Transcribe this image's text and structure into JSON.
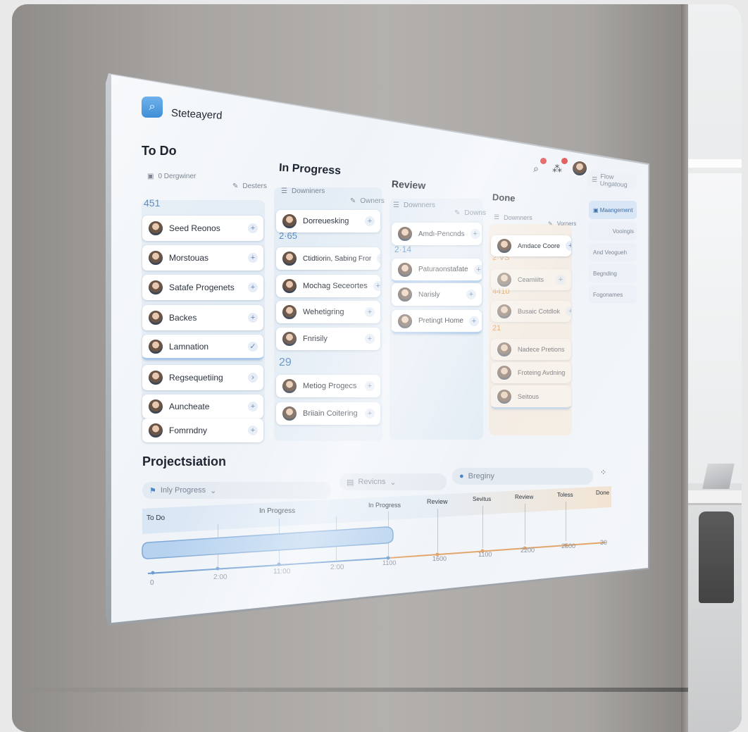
{
  "app": {
    "logo_icon": "search-icon",
    "name": "Steteayerd"
  },
  "topbar": {
    "icons": [
      "search-icon",
      "people-icon"
    ],
    "menu_pill": "Flow Ungatoug"
  },
  "columns": {
    "todo": {
      "title": "To Do",
      "filter_left": "0 Dergwiner",
      "filter_right": "Desters",
      "count": "451",
      "cards": [
        "Seed Reonos",
        "Morstouas",
        "Satafe Progenets",
        "Backes",
        "Lamnation",
        "Regsequetiing",
        "Auncheate",
        "Fomrndny"
      ]
    },
    "inprogress": {
      "title": "In Progress",
      "filter_left": "Downiners",
      "filter_right": "Owners",
      "count": "2·65",
      "count2": "29",
      "cards": [
        "Dorreuesking",
        "Ctidtiorin, Sabing Fror",
        "Mochag Seceortes",
        "Wehetigring",
        "Fnrisily",
        "Metiog Progecs",
        "Briiain Coitering"
      ]
    },
    "review": {
      "title": "Review",
      "filter_left": "Downners",
      "filter_right": "Downs",
      "count": "2·14",
      "cards": [
        "Amdı-Pencnds",
        "Paturaonstafate",
        "Narisly",
        "Pretingt Home"
      ]
    },
    "done": {
      "title": "Done",
      "filter_left": "Downners",
      "filter_right": "Vorners",
      "count": "2·VS",
      "count2": "4410",
      "count3": "21",
      "cards": [
        "Amdace Coore",
        "Ceamiiits",
        "Busaic Cotdlok",
        "Nadece Pretions",
        "Froteing Avdning",
        "Seitous"
      ]
    }
  },
  "side_menu": [
    "Maangement",
    "Vooingis",
    "And Veogueh",
    "Begnding",
    "Fogonames"
  ],
  "timeline": {
    "title": "Projectsiation",
    "filter1": "Inly Progress",
    "filter2": "Revicns",
    "filter3": "Breginy",
    "stages": [
      "To Do",
      "In Progress",
      "In Progress",
      "Review",
      "Sevitus",
      "Review",
      "Toless",
      "Done"
    ],
    "ticks": [
      "0",
      "2:00",
      "11:00",
      "2:00",
      "1100",
      "1600",
      "1100",
      "2200",
      "2500",
      "30"
    ]
  }
}
